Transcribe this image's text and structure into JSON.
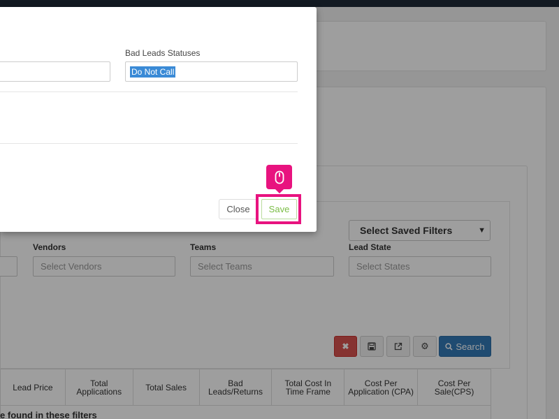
{
  "modal": {
    "bad_leads_label": "Bad Leads Statuses",
    "bad_leads_tag": "Do Not Call",
    "close_label": "Close",
    "save_label": "Save"
  },
  "filters": {
    "saved_filters": "Select Saved Filters",
    "vendors_label": "Vendors",
    "vendors_placeholder": "Select Vendors",
    "teams_label": "Teams",
    "teams_placeholder": "Select Teams",
    "state_label": "Lead State",
    "state_placeholder": "Select States"
  },
  "toolbar": {
    "clear_icon": "times-icon",
    "save_icon": "floppy-disk-icon",
    "export_icon": "external-link-icon",
    "settings_icon": "gear-icon",
    "search_label": "Search"
  },
  "table": {
    "headers": [
      "Lead Price",
      "Total Applications",
      "Total Sales",
      "Bad Leads/Returns",
      "Total Cost In Time Frame",
      "Cost Per Application (CPA)",
      "Cost Per Sale(CPS)"
    ],
    "empty_message": "re found in these filters"
  },
  "colors": {
    "highlight": "#e8137f",
    "save_text": "#7bbd46",
    "search_button": "#337ab7",
    "clear_button": "#d9534f",
    "tag": "#3a8ad6"
  }
}
